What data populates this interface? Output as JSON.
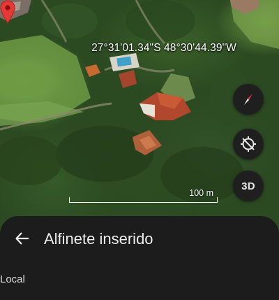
{
  "map": {
    "coordinates_label": "27°31'01.34\"S 48°30'44.39\"W",
    "scale_label": "100 m",
    "pin_color": "#e53935"
  },
  "controls": {
    "compass_icon": "compass-icon",
    "locate_icon": "location-target-icon",
    "three_d_label": "3D"
  },
  "sheet": {
    "back_icon": "back-arrow-icon",
    "title": "Alfinete inserido",
    "subtitle_partial": "Local"
  }
}
